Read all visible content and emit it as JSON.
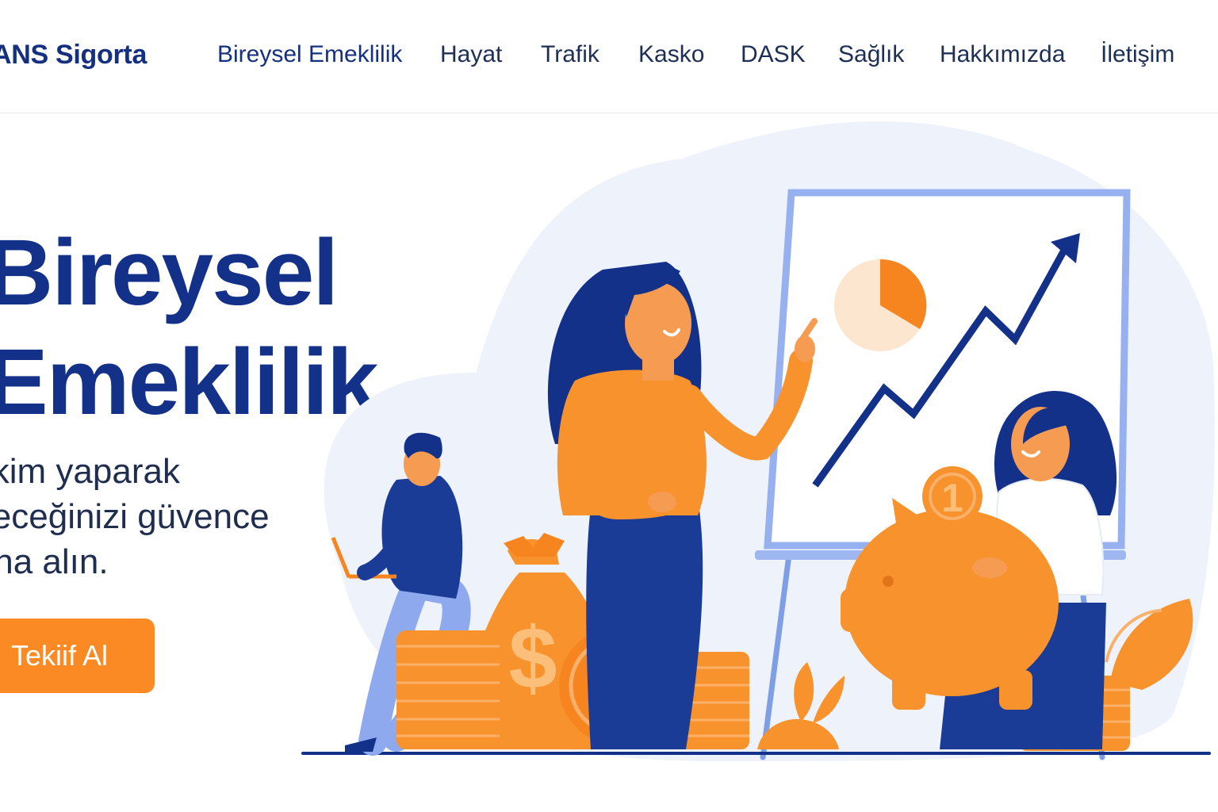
{
  "brand": "ANS Sigorta",
  "nav": {
    "items": [
      {
        "label": "Bireysel Emeklilik",
        "active": true
      },
      {
        "label": "Hayat"
      },
      {
        "label": "Trafik"
      },
      {
        "label": "Kasko"
      },
      {
        "label": "DASK"
      },
      {
        "label": "Sağlık"
      },
      {
        "label": "Hakkımızda"
      },
      {
        "label": "İletişim"
      }
    ]
  },
  "hero": {
    "title_lines": [
      "Bireysel",
      "Emeklilik"
    ],
    "subtitle_lines": [
      "ikim yaparak",
      "leceğinizi güvence",
      "ına alın."
    ],
    "cta_label": "Tekiif Al"
  },
  "colors": {
    "primary": "#15307e",
    "accent": "#fb8a24",
    "text": "#1e2f55"
  },
  "illustration": {
    "icons": [
      "woman-presenter",
      "growth-chart-board",
      "pie-chart",
      "trend-arrow",
      "man-with-laptop",
      "money-bag",
      "dollar-coin",
      "coin-stacks",
      "piggy-bank",
      "woman-with-piggy-bank",
      "plant-leaves"
    ],
    "coin_symbols": [
      "$",
      "$",
      "1"
    ]
  }
}
